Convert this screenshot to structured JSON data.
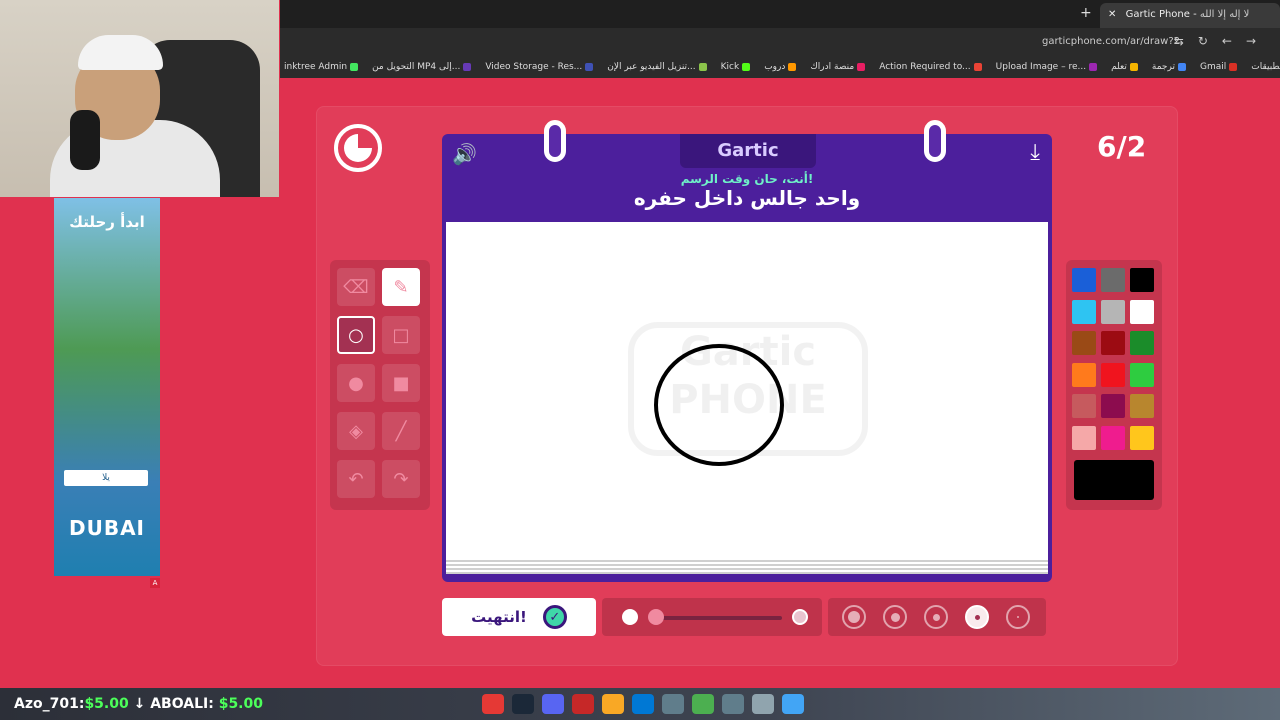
{
  "browser": {
    "tab_title": "Gartic Phone - ",
    "tab_title_overlay": "لا إله إلا الله",
    "url": "garticphone.com/ar/draw?2",
    "bookmarks": [
      {
        "label": "التطبيقات",
        "color": "#888888"
      },
      {
        "label": "Gmail",
        "color": "#d93025"
      },
      {
        "label": "ترجمة",
        "color": "#4285f4"
      },
      {
        "label": "تعلم",
        "color": "#f4b400"
      },
      {
        "label": "Upload Image – re...",
        "color": "#9c27b0"
      },
      {
        "label": "Action Required to...",
        "color": "#ea4335"
      },
      {
        "label": "منصة ادراك",
        "color": "#e91e63"
      },
      {
        "label": "دروب",
        "color": "#ff9800"
      },
      {
        "label": "Kick",
        "color": "#53fc18"
      },
      {
        "label": "تنزيل الفيديو عبر الإن...",
        "color": "#8bc34a"
      },
      {
        "label": "Video Storage - Res...",
        "color": "#3f51b5"
      },
      {
        "label": "التحويل من MP4 إلى...",
        "color": "#673ab7"
      },
      {
        "label": "inktree Admin",
        "color": "#43e660"
      }
    ]
  },
  "ad": {
    "headline": "ابدأ رحلتك",
    "cta": "يلا",
    "brand": "DUBAI",
    "badge": "A"
  },
  "game": {
    "round": "6/2",
    "logo": "Gartic",
    "prompt_intro": "أنت، حان وقت الرسم!",
    "prompt": "واحد جالس داخل حفره",
    "watermark": "Gartic PHONE",
    "done_label": "انتهيت!",
    "tools": [
      {
        "name": "pen-tool",
        "icon": "✎",
        "state": "active"
      },
      {
        "name": "eraser-tool",
        "icon": "⌫",
        "state": ""
      },
      {
        "name": "square-outline-tool",
        "icon": "□",
        "state": ""
      },
      {
        "name": "circle-outline-tool",
        "icon": "○",
        "state": "selected"
      },
      {
        "name": "square-filled-tool",
        "icon": "■",
        "state": ""
      },
      {
        "name": "circle-filled-tool",
        "icon": "●",
        "state": ""
      },
      {
        "name": "line-tool",
        "icon": "╱",
        "state": ""
      },
      {
        "name": "fill-bucket-tool",
        "icon": "◈",
        "state": ""
      },
      {
        "name": "redo-tool",
        "icon": "↷",
        "state": ""
      },
      {
        "name": "undo-tool",
        "icon": "↶",
        "state": ""
      }
    ],
    "palette": [
      "#1a5fd8",
      "#6b6b6b",
      "#000000",
      "#2ec4f2",
      "#b5b5b5",
      "#ffffff",
      "#9a4a16",
      "#9c0b12",
      "#1b8c2a",
      "#ff7a1c",
      "#f0141e",
      "#2ecc40",
      "#c65a5e",
      "#8c0c4e",
      "#b8862e",
      "#f5a8a8",
      "#ef1c8e",
      "#ffc61c"
    ],
    "current_color": "#000000",
    "opacity_level": 1.0,
    "selected_brush_size": 4
  },
  "taskbar": {
    "donation_1_name": "Azo_701:",
    "donation_1_amount": "$5.00",
    "donation_2_name": "ABOALI:",
    "donation_2_amount": "$5.00",
    "icon_colors": [
      "#e53935",
      "#1b2838",
      "#5865f2",
      "#c62828",
      "#f9a825",
      "#0078d4",
      "#607d8b",
      "#4caf50",
      "#607d8b",
      "#90a4ae",
      "#42a5f5"
    ]
  }
}
